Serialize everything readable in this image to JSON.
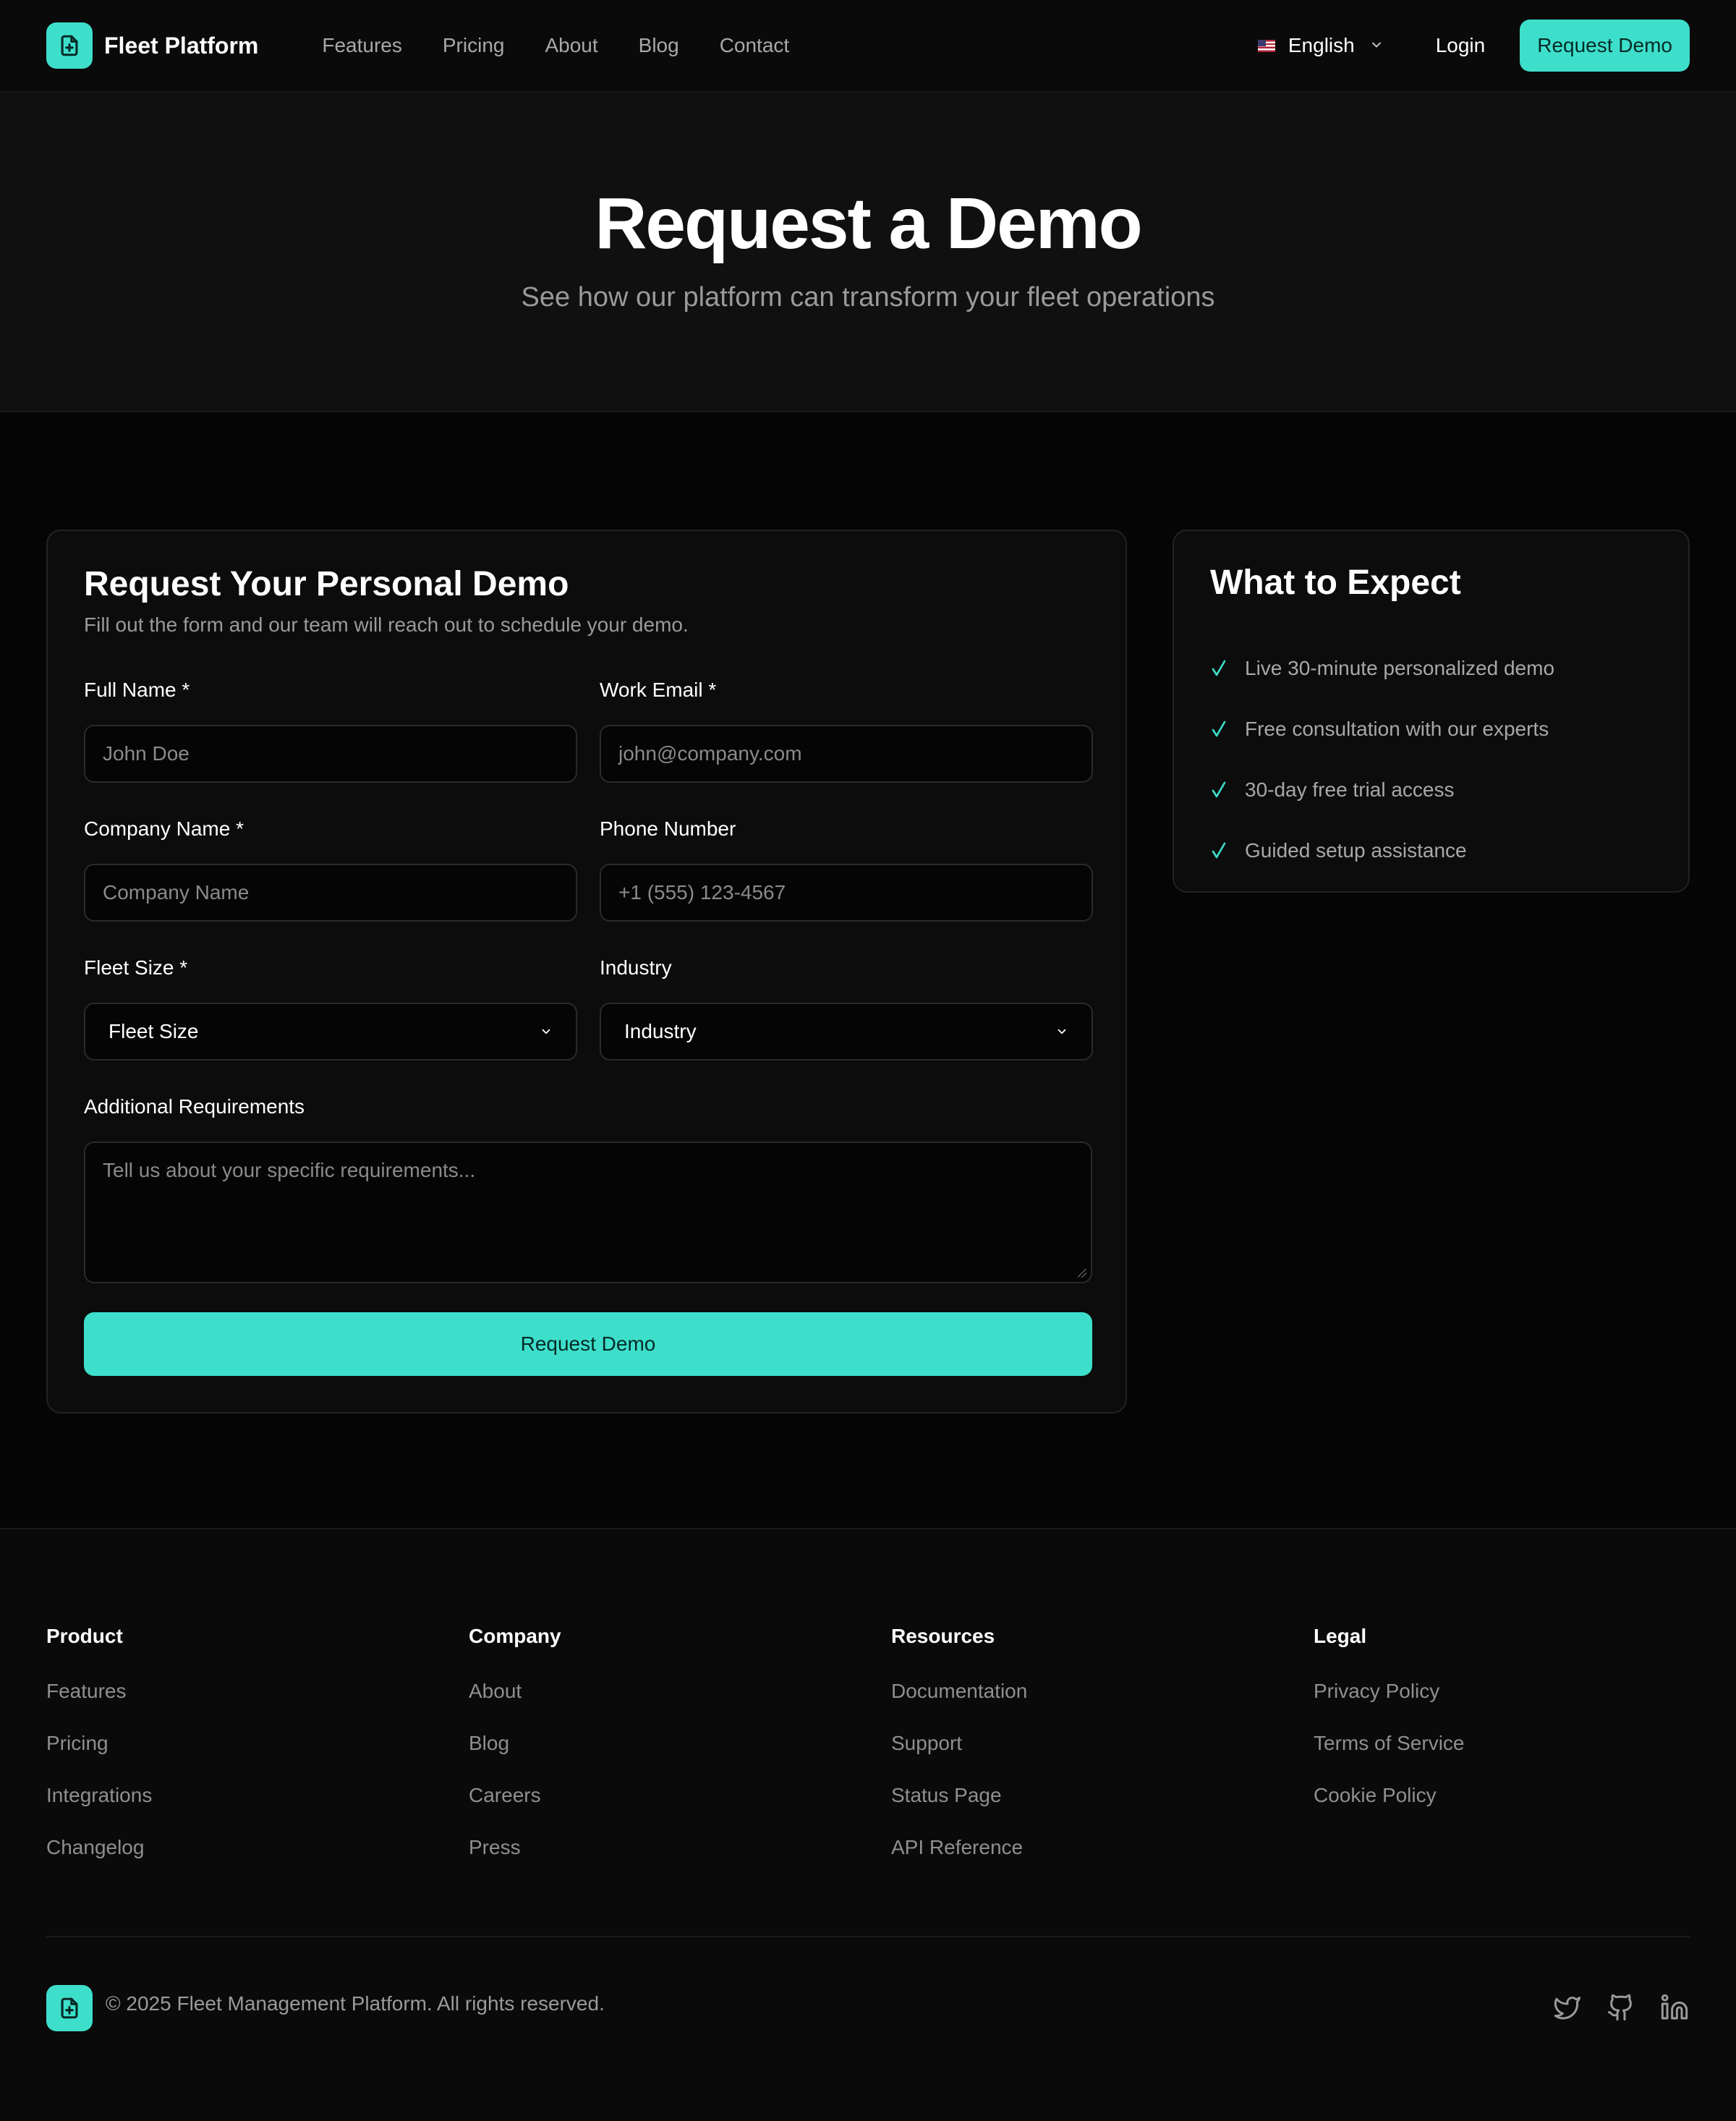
{
  "nav": {
    "brand": "Fleet Platform",
    "links": [
      "Features",
      "Pricing",
      "About",
      "Blog",
      "Contact"
    ],
    "language": "English",
    "login": "Login",
    "cta": "Request Demo"
  },
  "hero": {
    "title": "Request a Demo",
    "subtitle": "See how our platform can transform your fleet operations"
  },
  "form": {
    "title": "Request Your Personal Demo",
    "subtitle": "Fill out the form and our team will reach out to schedule your demo.",
    "full_name": {
      "label": "Full Name *",
      "placeholder": "John Doe"
    },
    "work_email": {
      "label": "Work Email *",
      "placeholder": "john@company.com"
    },
    "company_name": {
      "label": "Company Name *",
      "placeholder": "Company Name"
    },
    "phone": {
      "label": "Phone Number",
      "placeholder": "+1 (555) 123-4567"
    },
    "fleet_size": {
      "label": "Fleet Size *",
      "value": "Fleet Size"
    },
    "industry": {
      "label": "Industry",
      "value": "Industry"
    },
    "requirements": {
      "label": "Additional Requirements",
      "placeholder": "Tell us about your specific requirements..."
    },
    "submit": "Request Demo"
  },
  "expect": {
    "title": "What to Expect",
    "items": [
      "Live 30-minute personalized demo",
      "Free consultation with our experts",
      "30-day free trial access",
      "Guided setup assistance"
    ]
  },
  "footer": {
    "columns": [
      {
        "title": "Product",
        "links": [
          "Features",
          "Pricing",
          "Integrations",
          "Changelog"
        ]
      },
      {
        "title": "Company",
        "links": [
          "About",
          "Blog",
          "Careers",
          "Press"
        ]
      },
      {
        "title": "Resources",
        "links": [
          "Documentation",
          "Support",
          "Status Page",
          "API Reference"
        ]
      },
      {
        "title": "Legal",
        "links": [
          "Privacy Policy",
          "Terms of Service",
          "Cookie Policy"
        ]
      }
    ],
    "copyright": "© 2025 Fleet Management Platform. All rights reserved.",
    "socials": [
      "twitter-icon",
      "github-icon",
      "linkedin-icon"
    ]
  },
  "colors": {
    "accent": "#3ddfcb",
    "background": "#050505",
    "surface": "#0c0c0c",
    "muted_text": "#9a9a9a"
  }
}
